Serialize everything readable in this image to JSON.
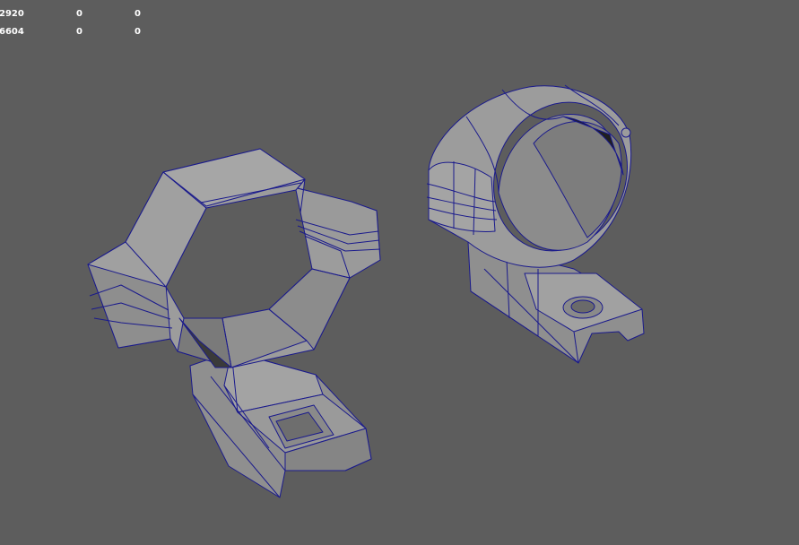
{
  "hud": {
    "rows": [
      {
        "values": [
          "2920",
          "0",
          "0"
        ]
      },
      {
        "values": [
          "6604",
          "0",
          "0"
        ]
      }
    ]
  },
  "viewport": {
    "background": "#5d5d5d",
    "mesh_fill": "#9a9a9a",
    "mesh_shadow": "#7c7c7c",
    "wire_color": "#1a1a8c",
    "objects": [
      "hexagonal-scope-mount",
      "round-scope-ring"
    ]
  }
}
